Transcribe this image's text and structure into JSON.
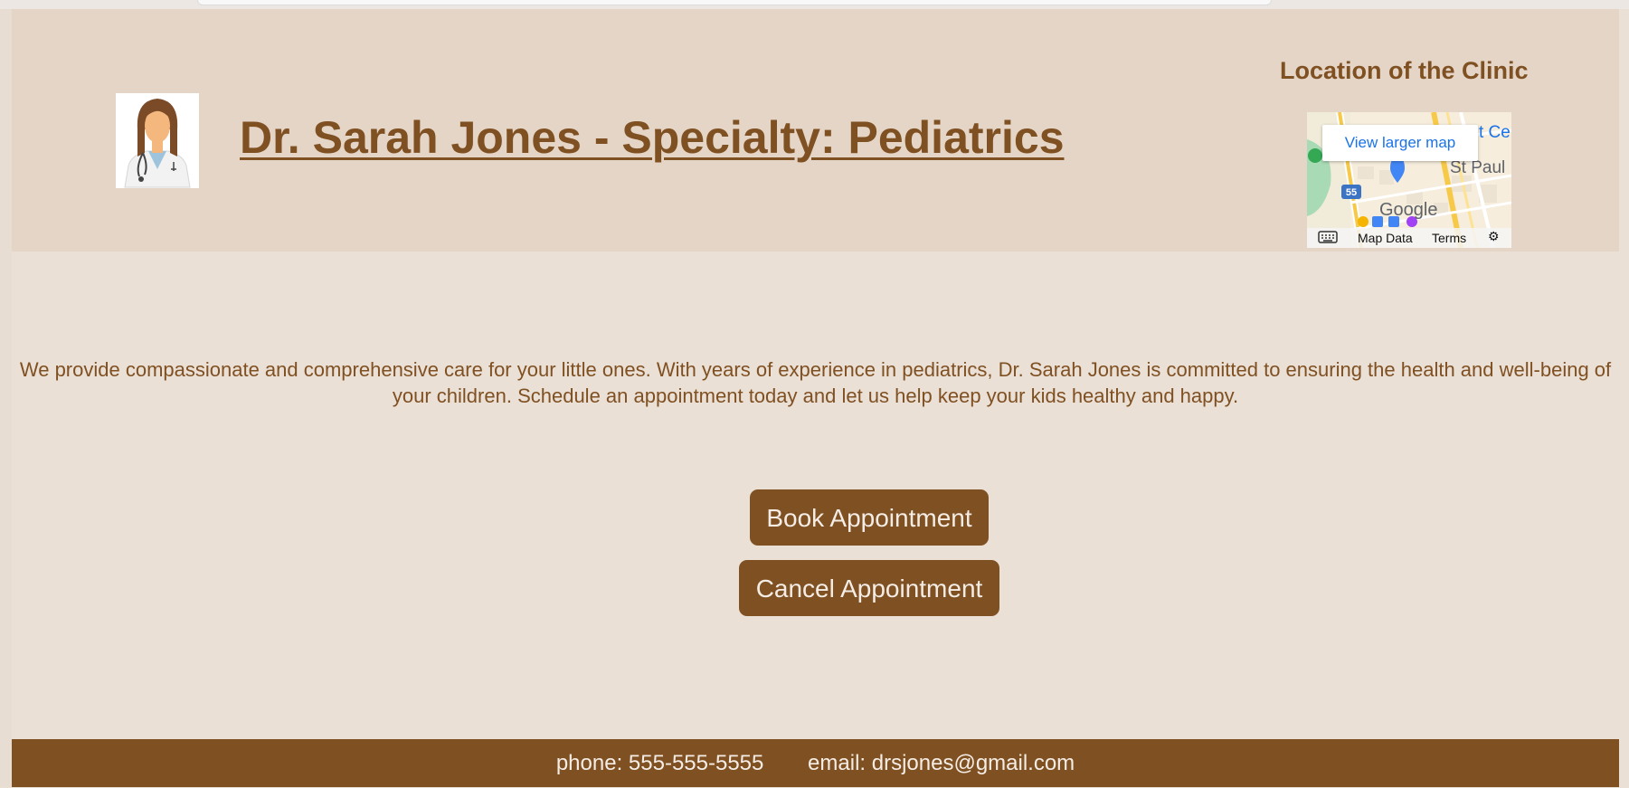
{
  "header": {
    "title": "Dr. Sarah Jones - Specialty: Pediatrics",
    "avatar_icon": "doctor-avatar-icon",
    "location_title": "Location of the Clinic"
  },
  "map": {
    "view_larger": "View larger map",
    "map_data": "Map Data",
    "terms": "Terms",
    "label_1": "St Paul",
    "label_2": "t Ce",
    "highway": "55",
    "brand": "Google",
    "keyboard_icon": "keyboard-icon",
    "report_icon": "gear-icon"
  },
  "main": {
    "description": "We provide compassionate and comprehensive care for your little ones. With years of experience in pediatrics, Dr. Sarah Jones is committed to ensuring the health and well-being of your children. Schedule an appointment today and let us help keep your kids healthy and happy.",
    "book_button": "Book Appointment",
    "cancel_button": "Cancel Appointment"
  },
  "footer": {
    "phone": "phone: 555-555-5555",
    "email": "email: drsjones@gmail.com"
  },
  "colors": {
    "brand_brown": "#7f5022",
    "header_bg": "#e5d5c6",
    "page_bg": "#ebe0d6"
  }
}
